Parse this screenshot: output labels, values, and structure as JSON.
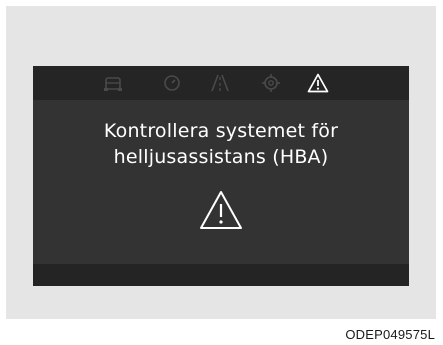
{
  "display": {
    "status_icons": [
      {
        "icon": "vehicle-icon",
        "active": false
      },
      {
        "icon": "gauge-icon",
        "active": false
      },
      {
        "icon": "lane-icon",
        "active": false
      },
      {
        "icon": "gear-icon",
        "active": false
      },
      {
        "icon": "warning-triangle-icon",
        "active": true
      }
    ],
    "message": {
      "line1": "Kontrollera systemet för",
      "line2": "helljusassistans (HBA)"
    },
    "center_icon": "warning-triangle-icon"
  },
  "caption": "ODEP049575L",
  "colors": {
    "panel": "#e5e5e5",
    "display": "#343435",
    "bar": "#252525",
    "dim_icon": "#4a4a4a",
    "active_icon": "#ffffff"
  }
}
